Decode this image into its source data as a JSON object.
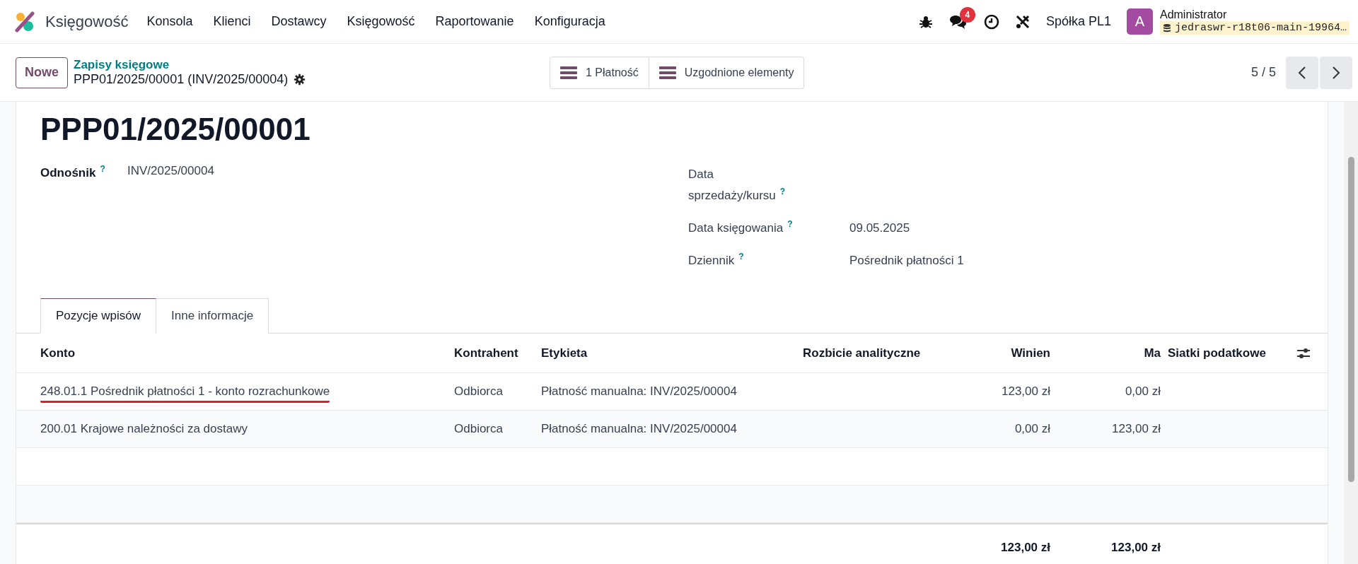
{
  "app": {
    "name": "Księgowość"
  },
  "menu": [
    "Konsola",
    "Klienci",
    "Dostawcy",
    "Księgowość",
    "Raportowanie",
    "Konfiguracja"
  ],
  "systray": {
    "chat_count": "4",
    "company": "Spółka PL1",
    "user": {
      "initial": "A",
      "name": "Administrator",
      "database": "jedraswr-r18t06-main-19964…"
    }
  },
  "control_panel": {
    "new_button": "Nowe",
    "breadcrumb": "Zapisy księgowe",
    "record": "PPP01/2025/00001 (INV/2025/00004)",
    "smart_buttons": [
      "1 Płatność",
      "Uzgodnione elementy"
    ],
    "pager": "5 / 5"
  },
  "form": {
    "title": "PPP01/2025/00001",
    "left_fields": [
      {
        "label": "Odnośnik",
        "help": "?",
        "value": "INV/2025/00004"
      }
    ],
    "right_fields": [
      {
        "label": "Data sprzedaży/kursu",
        "help": "?"
      },
      {
        "label": "Data księgowania",
        "help": "?",
        "value": "09.05.2025"
      },
      {
        "label": "Dziennik",
        "help": "?",
        "value": "Pośrednik płatności 1"
      }
    ]
  },
  "tabs": [
    {
      "label": "Pozycje wpisów",
      "selected": true
    },
    {
      "label": "Inne informacje",
      "selected": false
    }
  ],
  "table": {
    "columns": [
      {
        "label": "Konto",
        "kind": "text"
      },
      {
        "label": "Kontrahent",
        "kind": "text"
      },
      {
        "label": "Etykieta",
        "kind": "text"
      },
      {
        "label": "Rozbicie analityczne",
        "kind": "text"
      },
      {
        "label": "Winien",
        "kind": "amount"
      },
      {
        "label": "Ma",
        "kind": "amount"
      },
      {
        "label": "Siatki podatkowe",
        "kind": "text"
      }
    ],
    "rows": [
      {
        "cells": [
          "248.01.1 Pośrednik płatności 1 - konto rozrachunkowe",
          "Odbiorca",
          "Płatność manualna: INV/2025/00004",
          "",
          "123,00 zł",
          "0,00 zł",
          ""
        ],
        "underlined": true
      },
      {
        "cells": [
          "200.01 Krajowe należności za dostawy",
          "Odbiorca",
          "Płatność manualna: INV/2025/00004",
          "",
          "0,00 zł",
          "123,00 zł",
          ""
        ],
        "underlined": false
      }
    ],
    "totals": [
      "123,00 zł",
      "123,00 zł"
    ]
  }
}
